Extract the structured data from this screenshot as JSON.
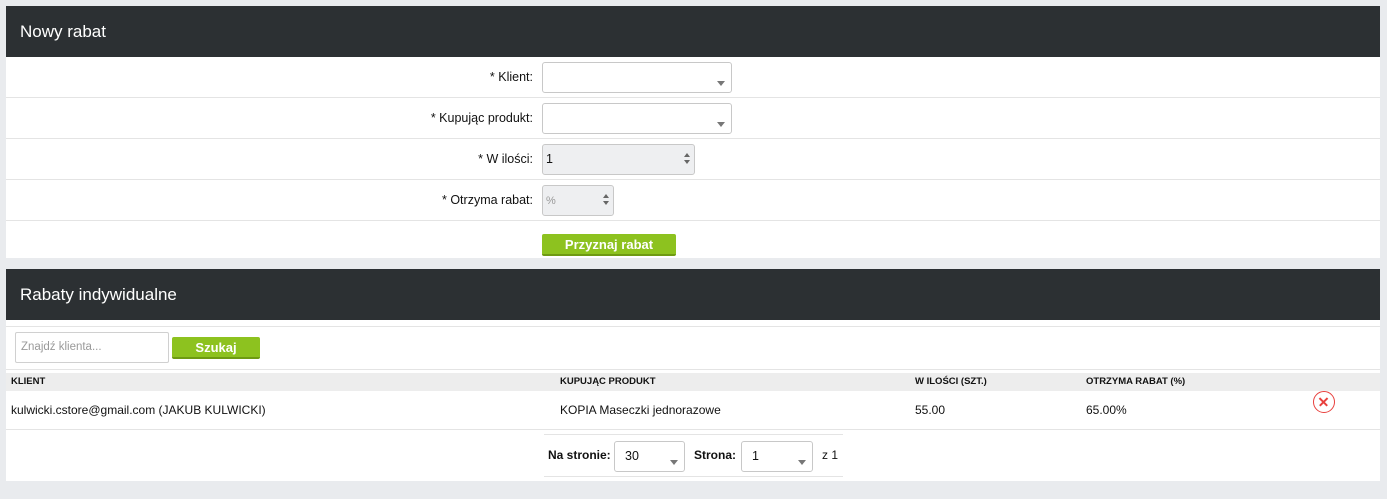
{
  "new_discount": {
    "title": "Nowy rabat",
    "client_label": "* Klient:",
    "client_value": "",
    "product_label": "* Kupując produkt:",
    "product_value": "",
    "quantity_label": "* W ilości:",
    "quantity_value": "1",
    "discount_label": "* Otrzyma rabat:",
    "discount_placeholder": "%",
    "submit_label": "Przyznaj rabat"
  },
  "individual": {
    "title": "Rabaty indywidualne",
    "search_placeholder": "Znajdź klienta...",
    "search_button": "Szukaj",
    "columns": [
      "KLIENT",
      "KUPUJĄC PRODUKT",
      "W ILOŚCI (SZT.)",
      "OTRZYMA RABAT (%)"
    ],
    "rows": [
      {
        "client": "kulwicki.cstore@gmail.com (JAKUB KULWICKI)",
        "product": "KOPIA Maseczki jednorazowe",
        "quantity": "55.00",
        "discount": "65.00%",
        "delete_icon": "circle-x-icon"
      }
    ],
    "pager": {
      "per_page_label": "Na stronie:",
      "per_page_value": "30",
      "page_label": "Strona:",
      "page_value": "1",
      "of_text": "z 1"
    }
  },
  "colors": {
    "header_bg": "#2c3033",
    "accent_green": "#8dc21f",
    "delete_red": "#e8403d"
  }
}
